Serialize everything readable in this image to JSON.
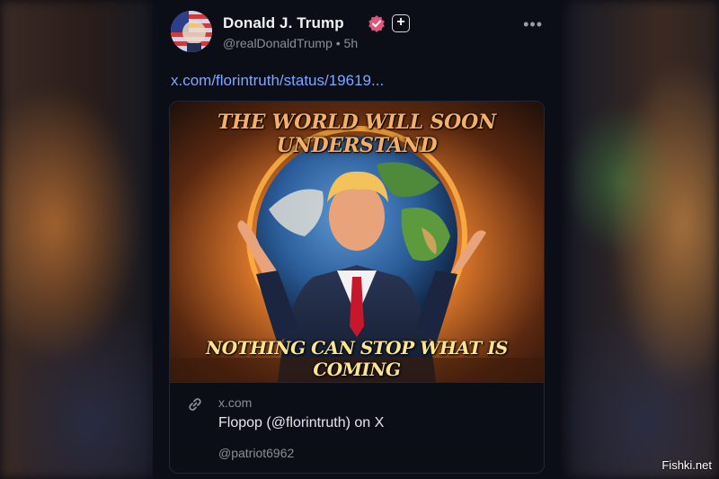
{
  "post": {
    "author_name": "Donald J. Trump",
    "handle": "@realDonaldTrump",
    "separator": "•",
    "time": "5h",
    "link_text": "x.com/florintruth/status/19619...",
    "badges": {
      "verified_color": "#e0567c",
      "verified_icon": "verified-badge-icon",
      "plus_icon": "plus-badge-icon"
    },
    "more_icon": "more-options-icon"
  },
  "card": {
    "headline": "THE WORLD WILL SOON UNDERSTAND",
    "subline": "NOTHING CAN STOP WHAT IS COMING",
    "domain": "x.com",
    "title": "Flopop (@florintruth) on X",
    "subtitle": "@patriot6962",
    "link_icon": "link-icon"
  },
  "watermark": "Fishki.net",
  "colors": {
    "panel_bg": "#0b0d17",
    "link": "#7fa7ff",
    "headline": "#f2b06a",
    "subline": "#fbe58d"
  }
}
